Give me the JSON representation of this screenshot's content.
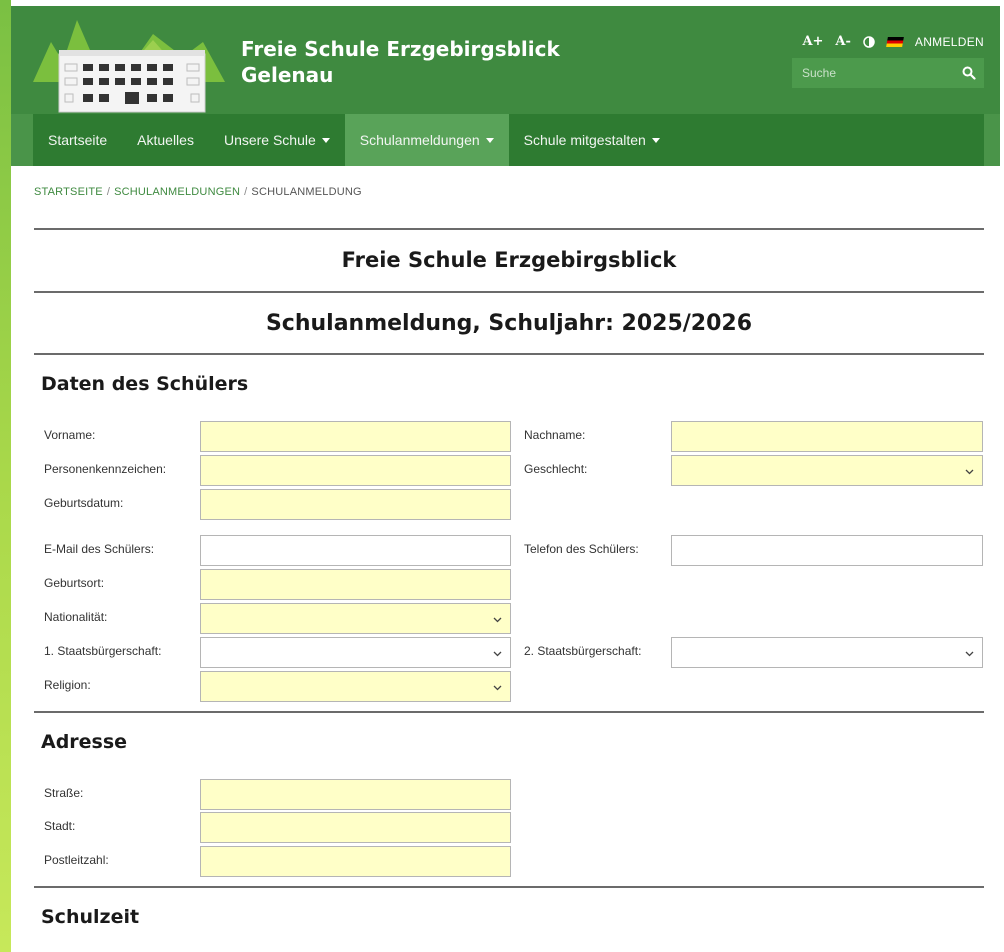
{
  "site": {
    "title_line1": "Freie Schule Erzgebirgsblick",
    "title_line2": "Gelenau"
  },
  "tools": {
    "font_increase": "A+",
    "font_decrease": "A-",
    "contrast_icon": "contrast-icon",
    "language_icon": "german-flag-icon",
    "login": "ANMELDEN"
  },
  "search": {
    "placeholder": "Suche",
    "icon": "search-icon"
  },
  "nav": {
    "items": [
      {
        "label": "Startseite"
      },
      {
        "label": "Aktuelles"
      },
      {
        "label": "Unsere Schule"
      },
      {
        "label": "Schulanmeldungen"
      },
      {
        "label": "Schule mitgestalten"
      }
    ],
    "active": "Schulanmeldungen"
  },
  "breadcrumb": {
    "items": [
      "STARTSEITE",
      "SCHULANMELDUNGEN",
      "SCHULANMELDUNG"
    ],
    "separator": "/"
  },
  "page": {
    "school_heading": "Freie Schule Erzgebirgsblick",
    "form_heading": "Schulanmeldung, Schuljahr: 2025/2026"
  },
  "sections": {
    "student": {
      "title": "Daten des Schülers",
      "fields": {
        "vorname": "Vorname:",
        "nachname": "Nachname:",
        "personenkennzeichen": "Personenkennzeichen:",
        "geschlecht": "Geschlecht:",
        "geburtsdatum": "Geburtsdatum:",
        "email": "E-Mail des Schülers:",
        "telefon": "Telefon des Schülers:",
        "geburtsort": "Geburtsort:",
        "nationalitaet": "Nationalität:",
        "staatsbuergerschaft1": "1. Staatsbürgerschaft:",
        "staatsbuergerschaft2": "2. Staatsbürgerschaft:",
        "religion": "Religion:"
      }
    },
    "address": {
      "title": "Adresse",
      "fields": {
        "strasse": "Straße:",
        "stadt": "Stadt:",
        "plz": "Postleitzahl:"
      }
    },
    "schooltime": {
      "title": "Schulzeit"
    }
  },
  "colors": {
    "header_green": "#3f8a40",
    "nav_green": "#2e7b31",
    "nav_active": "#59a359",
    "required_field": "#ffffc8"
  }
}
